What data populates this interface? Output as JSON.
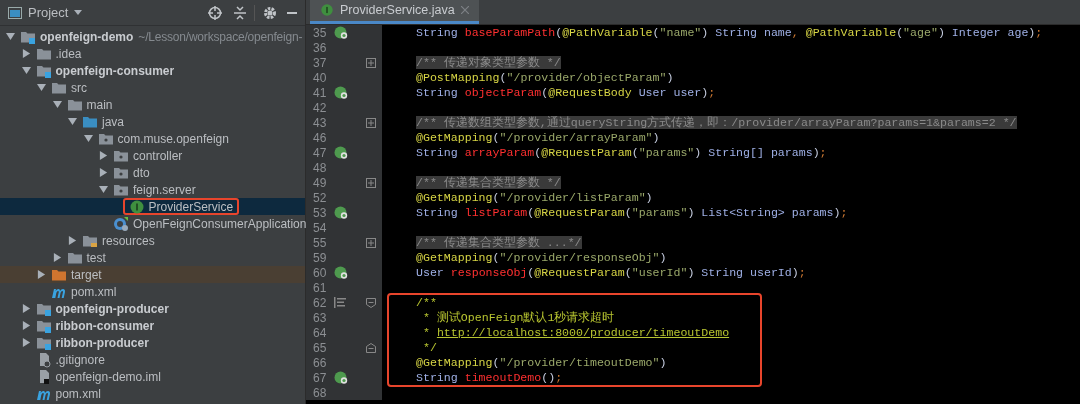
{
  "project_panel": {
    "title": "Project",
    "tree": [
      {
        "label": "openfeign-demo",
        "suffix": "~/Lesson/workspace/openfeign-",
        "kind": "module",
        "expanded": true,
        "children": [
          {
            "label": ".idea",
            "kind": "folder",
            "expanded": false
          },
          {
            "label": "openfeign-consumer",
            "kind": "module",
            "expanded": true,
            "children": [
              {
                "label": "src",
                "kind": "folder",
                "expanded": true,
                "children": [
                  {
                    "label": "main",
                    "kind": "folder",
                    "expanded": true,
                    "children": [
                      {
                        "label": "java",
                        "kind": "source",
                        "expanded": true,
                        "children": [
                          {
                            "label": "com.muse.openfeign",
                            "kind": "package",
                            "expanded": true,
                            "children": [
                              {
                                "label": "controller",
                                "kind": "package",
                                "expanded": false
                              },
                              {
                                "label": "dto",
                                "kind": "package",
                                "expanded": false
                              },
                              {
                                "label": "feign.server",
                                "kind": "package",
                                "expanded": true,
                                "children": [
                                  {
                                    "label": "ProviderService",
                                    "kind": "interface",
                                    "selected": true,
                                    "boxed": true
                                  }
                                ]
                              },
                              {
                                "label": "OpenFeignConsumerApplication",
                                "kind": "spring",
                                "selected": false,
                                "boxed": false
                              }
                            ]
                          }
                        ]
                      },
                      {
                        "label": "resources",
                        "kind": "resources",
                        "expanded": false
                      }
                    ]
                  },
                  {
                    "label": "test",
                    "kind": "folder",
                    "expanded": false
                  }
                ]
              },
              {
                "label": "target",
                "kind": "excluded",
                "expanded": false,
                "excluded": true
              },
              {
                "label": "pom.xml",
                "kind": "maven"
              }
            ]
          },
          {
            "label": "openfeign-producer",
            "kind": "module",
            "expanded": false
          },
          {
            "label": "ribbon-consumer",
            "kind": "module",
            "expanded": false
          },
          {
            "label": "ribbon-producer",
            "kind": "module",
            "expanded": false
          },
          {
            "label": ".gitignore",
            "kind": "ignore"
          },
          {
            "label": "openfeign-demo.iml",
            "kind": "iml"
          },
          {
            "label": "pom.xml",
            "kind": "maven"
          }
        ]
      }
    ]
  },
  "editor": {
    "tab": {
      "label": "ProviderService.java",
      "selected": true
    },
    "lines": [
      {
        "number": "35",
        "marker": true,
        "tokens": [
          {
            "kind": "type",
            "text": "String "
          },
          {
            "kind": "method",
            "text": "baseParamPath"
          },
          {
            "kind": "plain",
            "text": "("
          },
          {
            "kind": "annotation",
            "text": "@PathVariable"
          },
          {
            "kind": "plain",
            "text": "("
          },
          {
            "kind": "string",
            "text": "\"name\""
          },
          {
            "kind": "plain",
            "text": ") "
          },
          {
            "kind": "type",
            "text": "String name"
          },
          {
            "kind": "punct",
            "text": ", "
          },
          {
            "kind": "annotation",
            "text": "@PathVariable"
          },
          {
            "kind": "plain",
            "text": "("
          },
          {
            "kind": "string",
            "text": "\"age\""
          },
          {
            "kind": "plain",
            "text": ") "
          },
          {
            "kind": "type",
            "text": "Integer age"
          },
          {
            "kind": "plain",
            "text": ")"
          },
          {
            "kind": "punct",
            "text": ";"
          }
        ]
      },
      {
        "number": "36"
      },
      {
        "number": "37",
        "fold": {
          "kind": "collapsed"
        },
        "tokens": [
          {
            "kind": "comment",
            "text": "/** 传递对象类型参数 */"
          }
        ]
      },
      {
        "number": "40",
        "tokens": [
          {
            "kind": "annotation",
            "text": "@PostMapping"
          },
          {
            "kind": "plain",
            "text": "("
          },
          {
            "kind": "string",
            "text": "\"/provider/objectParam\""
          },
          {
            "kind": "plain",
            "text": ")"
          }
        ]
      },
      {
        "number": "41",
        "marker": true,
        "tokens": [
          {
            "kind": "type",
            "text": "String "
          },
          {
            "kind": "method",
            "text": "objectParam"
          },
          {
            "kind": "plain",
            "text": "("
          },
          {
            "kind": "annotation",
            "text": "@RequestBody "
          },
          {
            "kind": "type",
            "text": "User user"
          },
          {
            "kind": "plain",
            "text": ")"
          },
          {
            "kind": "punct",
            "text": ";"
          }
        ]
      },
      {
        "number": "42"
      },
      {
        "number": "43",
        "fold": {
          "kind": "collapsed"
        },
        "tokens": [
          {
            "kind": "comment",
            "text": "/** 传递数组类型参数,通过queryString方式传递，即：/provider/arrayParam?params=1&params=2 */"
          }
        ]
      },
      {
        "number": "46",
        "tokens": [
          {
            "kind": "annotation",
            "text": "@GetMapping"
          },
          {
            "kind": "plain",
            "text": "("
          },
          {
            "kind": "string",
            "text": "\"/provider/arrayParam\""
          },
          {
            "kind": "plain",
            "text": ")"
          }
        ]
      },
      {
        "number": "47",
        "marker": true,
        "tokens": [
          {
            "kind": "type",
            "text": "String "
          },
          {
            "kind": "method",
            "text": "arrayParam"
          },
          {
            "kind": "plain",
            "text": "("
          },
          {
            "kind": "annotation",
            "text": "@RequestParam"
          },
          {
            "kind": "plain",
            "text": "("
          },
          {
            "kind": "string",
            "text": "\"params\""
          },
          {
            "kind": "plain",
            "text": ") "
          },
          {
            "kind": "type",
            "text": "String[] params"
          },
          {
            "kind": "plain",
            "text": ")"
          },
          {
            "kind": "punct",
            "text": ";"
          }
        ]
      },
      {
        "number": "48"
      },
      {
        "number": "49",
        "fold": {
          "kind": "collapsed"
        },
        "tokens": [
          {
            "kind": "comment",
            "text": "/** 传递集合类型参数 */"
          }
        ]
      },
      {
        "number": "52",
        "tokens": [
          {
            "kind": "annotation",
            "text": "@GetMapping"
          },
          {
            "kind": "plain",
            "text": "("
          },
          {
            "kind": "string",
            "text": "\"/provider/listParam\""
          },
          {
            "kind": "plain",
            "text": ")"
          }
        ]
      },
      {
        "number": "53",
        "marker": true,
        "tokens": [
          {
            "kind": "type",
            "text": "String "
          },
          {
            "kind": "method",
            "text": "listParam"
          },
          {
            "kind": "plain",
            "text": "("
          },
          {
            "kind": "annotation",
            "text": "@RequestParam"
          },
          {
            "kind": "plain",
            "text": "("
          },
          {
            "kind": "string",
            "text": "\"params\""
          },
          {
            "kind": "plain",
            "text": ") "
          },
          {
            "kind": "type",
            "text": "List<String> params"
          },
          {
            "kind": "plain",
            "text": ")"
          },
          {
            "kind": "punct",
            "text": ";"
          }
        ]
      },
      {
        "number": "54"
      },
      {
        "number": "55",
        "fold": {
          "kind": "collapsed"
        },
        "tokens": [
          {
            "kind": "comment",
            "text": "/** 传递集合类型参数 ...*/"
          }
        ]
      },
      {
        "number": "59",
        "tokens": [
          {
            "kind": "annotation",
            "text": "@GetMapping"
          },
          {
            "kind": "plain",
            "text": "("
          },
          {
            "kind": "string",
            "text": "\"/provider/responseObj\""
          },
          {
            "kind": "plain",
            "text": ")"
          }
        ]
      },
      {
        "number": "60",
        "marker": true,
        "tokens": [
          {
            "kind": "type",
            "text": "User "
          },
          {
            "kind": "method",
            "text": "responseObj"
          },
          {
            "kind": "plain",
            "text": "("
          },
          {
            "kind": "annotation",
            "text": "@RequestParam"
          },
          {
            "kind": "plain",
            "text": "("
          },
          {
            "kind": "string",
            "text": "\"userId\""
          },
          {
            "kind": "plain",
            "text": ") "
          },
          {
            "kind": "type",
            "text": "String userId"
          },
          {
            "kind": "plain",
            "text": ")"
          },
          {
            "kind": "punct",
            "text": ";"
          }
        ]
      },
      {
        "number": "61"
      },
      {
        "number": "62",
        "doc_icon": true,
        "fold": {
          "kind": "open"
        },
        "boxed": true,
        "tokens": [
          {
            "kind": "doc",
            "text": "/**"
          }
        ]
      },
      {
        "number": "63",
        "boxed": true,
        "tokens": [
          {
            "kind": "doc",
            "text": " * 测试OpenFeign默认1秒请求超时"
          }
        ]
      },
      {
        "number": "64",
        "boxed": true,
        "tokens": [
          {
            "kind": "doc",
            "text": " * "
          },
          {
            "kind": "link",
            "text": "http://localhost:8000/producer/timeoutDemo"
          }
        ]
      },
      {
        "number": "65",
        "fold": {
          "kind": "end"
        },
        "boxed": true,
        "tokens": [
          {
            "kind": "doc",
            "text": " */"
          }
        ]
      },
      {
        "number": "66",
        "boxed": true,
        "tokens": [
          {
            "kind": "annotation",
            "text": "@GetMapping"
          },
          {
            "kind": "plain",
            "text": "("
          },
          {
            "kind": "string",
            "text": "\"/provider/timeoutDemo\""
          },
          {
            "kind": "plain",
            "text": ")"
          }
        ]
      },
      {
        "number": "67",
        "marker": true,
        "boxed": true,
        "tokens": [
          {
            "kind": "type",
            "text": "String "
          },
          {
            "kind": "method",
            "text": "timeoutDemo"
          },
          {
            "kind": "plain",
            "text": "()"
          },
          {
            "kind": "punct",
            "text": ";"
          }
        ]
      },
      {
        "number": "68"
      }
    ]
  }
}
